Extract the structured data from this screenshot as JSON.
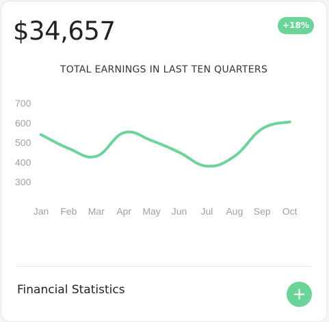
{
  "card": {
    "amount": "$34,657",
    "badge": "+18%",
    "chart_title": "TOTAL EARNINGS IN LAST TEN QUARTERS",
    "footer_label": "Financial Statistics",
    "add_icon": "+"
  },
  "colors": {
    "accent": "#6ad499",
    "tick_text": "#a0a0a0"
  },
  "chart_data": {
    "type": "line",
    "categories": [
      "Jan",
      "Feb",
      "Mar",
      "Apr",
      "May",
      "Jun",
      "Jul",
      "Aug",
      "Sep",
      "Oct"
    ],
    "y_ticks": [
      300,
      400,
      500,
      600,
      700
    ],
    "series": [
      {
        "values": [
          540,
          470,
          430,
          550,
          510,
          450,
          380,
          430,
          570,
          605
        ]
      }
    ],
    "ylim": [
      300,
      700
    ],
    "grid": false,
    "title": "TOTAL EARNINGS IN LAST TEN QUARTERS"
  }
}
